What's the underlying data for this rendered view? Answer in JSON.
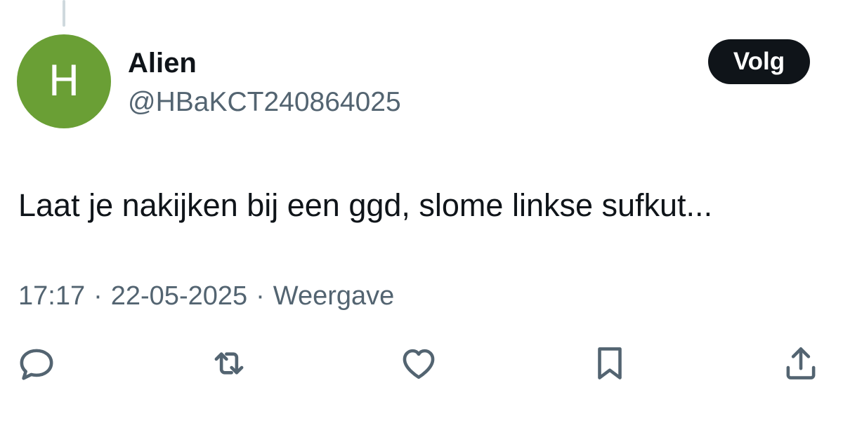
{
  "author": {
    "avatar_letter": "H",
    "avatar_color": "#6a9f35",
    "display_name": "Alien",
    "handle": "@HBaKCT240864025"
  },
  "follow_button": {
    "label": "Volg"
  },
  "tweet": {
    "text": "Laat je nakijken bij een ggd, slome linkse sufkut..."
  },
  "meta": {
    "time": "17:17",
    "separator": "·",
    "date": "22-05-2025",
    "views_label": "Weergave"
  },
  "actions": [
    {
      "icon": "reply-icon"
    },
    {
      "icon": "repost-icon"
    },
    {
      "icon": "like-icon"
    },
    {
      "icon": "bookmark-icon"
    },
    {
      "icon": "share-icon"
    }
  ],
  "colors": {
    "text_primary": "#0f1419",
    "text_secondary": "#536471",
    "icon": "#536471",
    "thread_line": "#cfd9de"
  }
}
